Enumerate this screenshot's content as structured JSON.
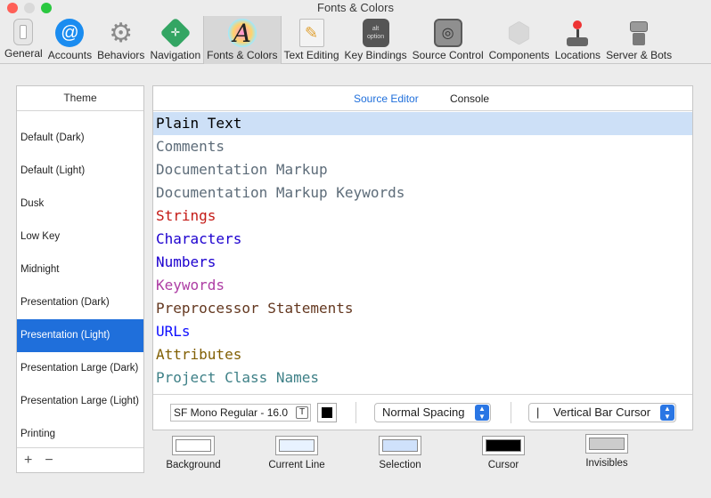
{
  "window": {
    "title": "Fonts & Colors"
  },
  "toolbar": [
    {
      "label": "General",
      "icon": "toggle-switch-icon"
    },
    {
      "label": "Accounts",
      "icon": "at-sign-icon"
    },
    {
      "label": "Behaviors",
      "icon": "gear-icon"
    },
    {
      "label": "Navigation",
      "icon": "navigation-arrows-icon"
    },
    {
      "label": "Fonts & Colors",
      "icon": "font-letter-a-icon"
    },
    {
      "label": "Text Editing",
      "icon": "notepad-pencil-icon"
    },
    {
      "label": "Key Bindings",
      "icon": "keyboard-keys-icon"
    },
    {
      "label": "Source Control",
      "icon": "vault-safe-icon"
    },
    {
      "label": "Components",
      "icon": "shield-box-icon"
    },
    {
      "label": "Locations",
      "icon": "joystick-icon"
    },
    {
      "label": "Server & Bots",
      "icon": "robot-icon"
    }
  ],
  "theme": {
    "header": "Theme",
    "items": [
      "Default (Dark)",
      "Default (Light)",
      "Dusk",
      "Low Key",
      "Midnight",
      "Presentation (Dark)",
      "Presentation (Light)",
      "Presentation Large (Dark)",
      "Presentation Large (Light)",
      "Printing"
    ],
    "selected": "Presentation (Light)",
    "add_label": "+",
    "remove_label": "−"
  },
  "tabs": {
    "source_editor": "Source Editor",
    "console": "Console"
  },
  "syntax": [
    {
      "label": "Plain Text",
      "color": "#000000"
    },
    {
      "label": "Comments",
      "color": "#5d6c79"
    },
    {
      "label": "Documentation Markup",
      "color": "#5d6c79"
    },
    {
      "label": "Documentation Markup Keywords",
      "color": "#5d6c79"
    },
    {
      "label": "Strings",
      "color": "#c41a16"
    },
    {
      "label": "Characters",
      "color": "#1c00cf"
    },
    {
      "label": "Numbers",
      "color": "#1c00cf"
    },
    {
      "label": "Keywords",
      "color": "#ad3da4"
    },
    {
      "label": "Preprocessor Statements",
      "color": "#643820"
    },
    {
      "label": "URLs",
      "color": "#0e0eff"
    },
    {
      "label": "Attributes",
      "color": "#815f03"
    },
    {
      "label": "Project Class Names",
      "color": "#3e8087"
    }
  ],
  "font_bar": {
    "font": "SF Mono Regular - 16.0",
    "font_button": "T",
    "spacing": "Normal Spacing",
    "cursor_glyph": "|",
    "cursor": "Vertical Bar Cursor"
  },
  "swatches": [
    {
      "label": "Background",
      "color": "#ffffff"
    },
    {
      "label": "Current Line",
      "color": "#e8f2ff"
    },
    {
      "label": "Selection",
      "color": "#cfe1fb"
    },
    {
      "label": "Cursor",
      "color": "#000000"
    },
    {
      "label": "Invisibles",
      "color": "#cccccc"
    }
  ]
}
